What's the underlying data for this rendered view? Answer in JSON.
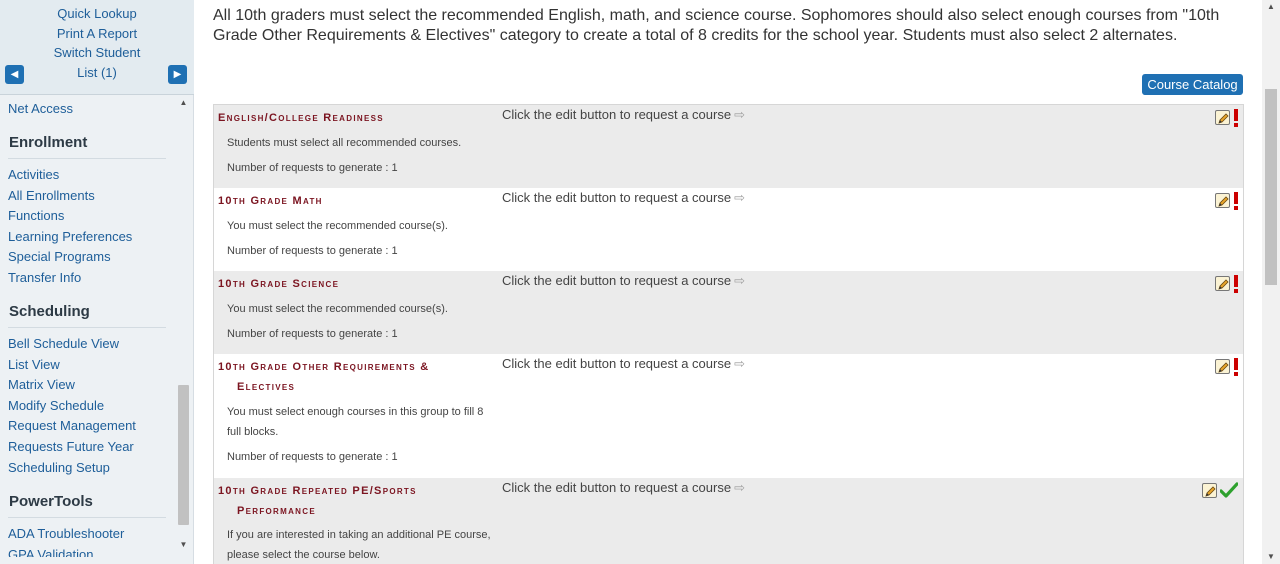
{
  "sidebar": {
    "top_links": [
      "Quick Lookup",
      "Print A Report",
      "Switch Student",
      "List (1)"
    ],
    "prev_arrow": "◀",
    "next_arrow": "▶",
    "net_access": "Net Access",
    "sections": [
      {
        "heading": "Enrollment",
        "items": [
          "Activities",
          "All Enrollments",
          "Functions",
          "Learning Preferences",
          "Special Programs",
          "Transfer Info"
        ]
      },
      {
        "heading": "Scheduling",
        "items": [
          "Bell Schedule View",
          "List View",
          "Matrix View",
          "Modify Schedule",
          "Request Management",
          "Requests Future Year",
          "Scheduling Setup"
        ]
      },
      {
        "heading": "PowerTools",
        "items": [
          "ADA Troubleshooter",
          "GPA Validation"
        ]
      }
    ]
  },
  "main": {
    "intro": "All 10th graders must select the recommended English, math, and science course. Sophomores should also select enough courses from \"10th Grade Other Requirements & Electives\" category to create a total of 8 credits for the school year. Students must also select 2 alternates.",
    "course_catalog_label": "Course Catalog",
    "instruction": "Click the edit button to request a course",
    "instruction_arrow": "⇨",
    "requests": [
      {
        "title": "English/College Readiness",
        "title2": "",
        "desc": "Students must select all recommended courses.",
        "generate": "Number of requests to generate : 1",
        "status": "incomplete"
      },
      {
        "title": "10th Grade Math",
        "title2": "",
        "desc": "You must select the recommended course(s).",
        "generate": "Number of requests to generate : 1",
        "status": "incomplete"
      },
      {
        "title": "10th Grade Science",
        "title2": "",
        "desc": "You must select the recommended course(s).",
        "generate": "Number of requests to generate : 1",
        "status": "incomplete"
      },
      {
        "title": "10th Grade Other Requirements &",
        "title2": "Electives",
        "desc": "You must select enough courses in this group to fill 8 full blocks.",
        "generate": "Number of requests to generate : 1",
        "status": "incomplete"
      },
      {
        "title": "10th Grade Repeated PE/Sports",
        "title2": "Performance",
        "desc": "If you are interested in taking an additional PE course, please select the course below.",
        "generate": "",
        "status": "complete"
      }
    ]
  },
  "colors": {
    "link": "#1e5e99",
    "accent_button": "#1f70b3",
    "title_maroon": "#7b1420",
    "incomplete_red": "#cc0000",
    "complete_green": "#2ea12e"
  },
  "icons": {
    "edit": "edit-pencil-icon",
    "incomplete": "exclamation-icon",
    "complete": "checkmark-icon"
  }
}
